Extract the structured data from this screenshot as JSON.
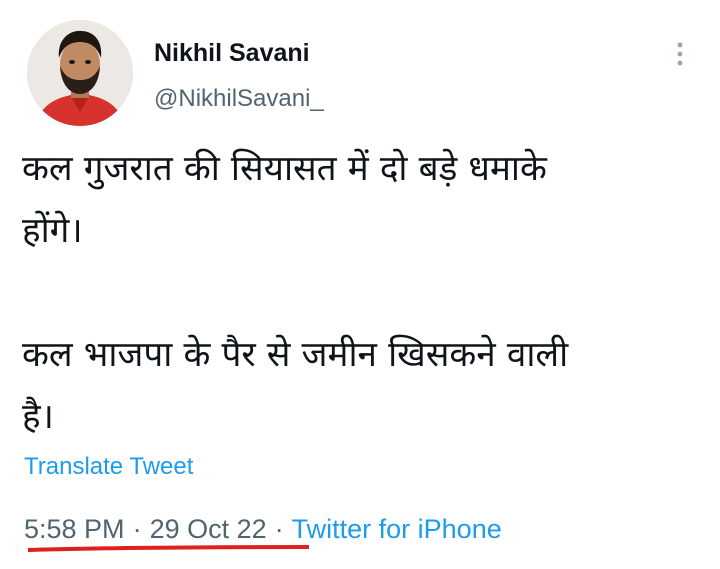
{
  "user": {
    "display_name": "Nikhil Savani",
    "handle": "@NikhilSavani_"
  },
  "tweet": {
    "text": "कल गुजरात की सियासत में दो बड़े धमाके\nहोंगे।\n\nकल भाजपा के पैर से जमीन खिसकने वाली\nहै।",
    "translate_label": "Translate Tweet",
    "time": "5:58 PM",
    "separator": "·",
    "date": "29 Oct 22",
    "source": "Twitter for iPhone"
  },
  "colors": {
    "link_blue": "#1d9bf0",
    "secondary_text": "#536471",
    "annotation_underline": "#e0201b"
  },
  "icons": {
    "more": "more-vertical-icon"
  }
}
